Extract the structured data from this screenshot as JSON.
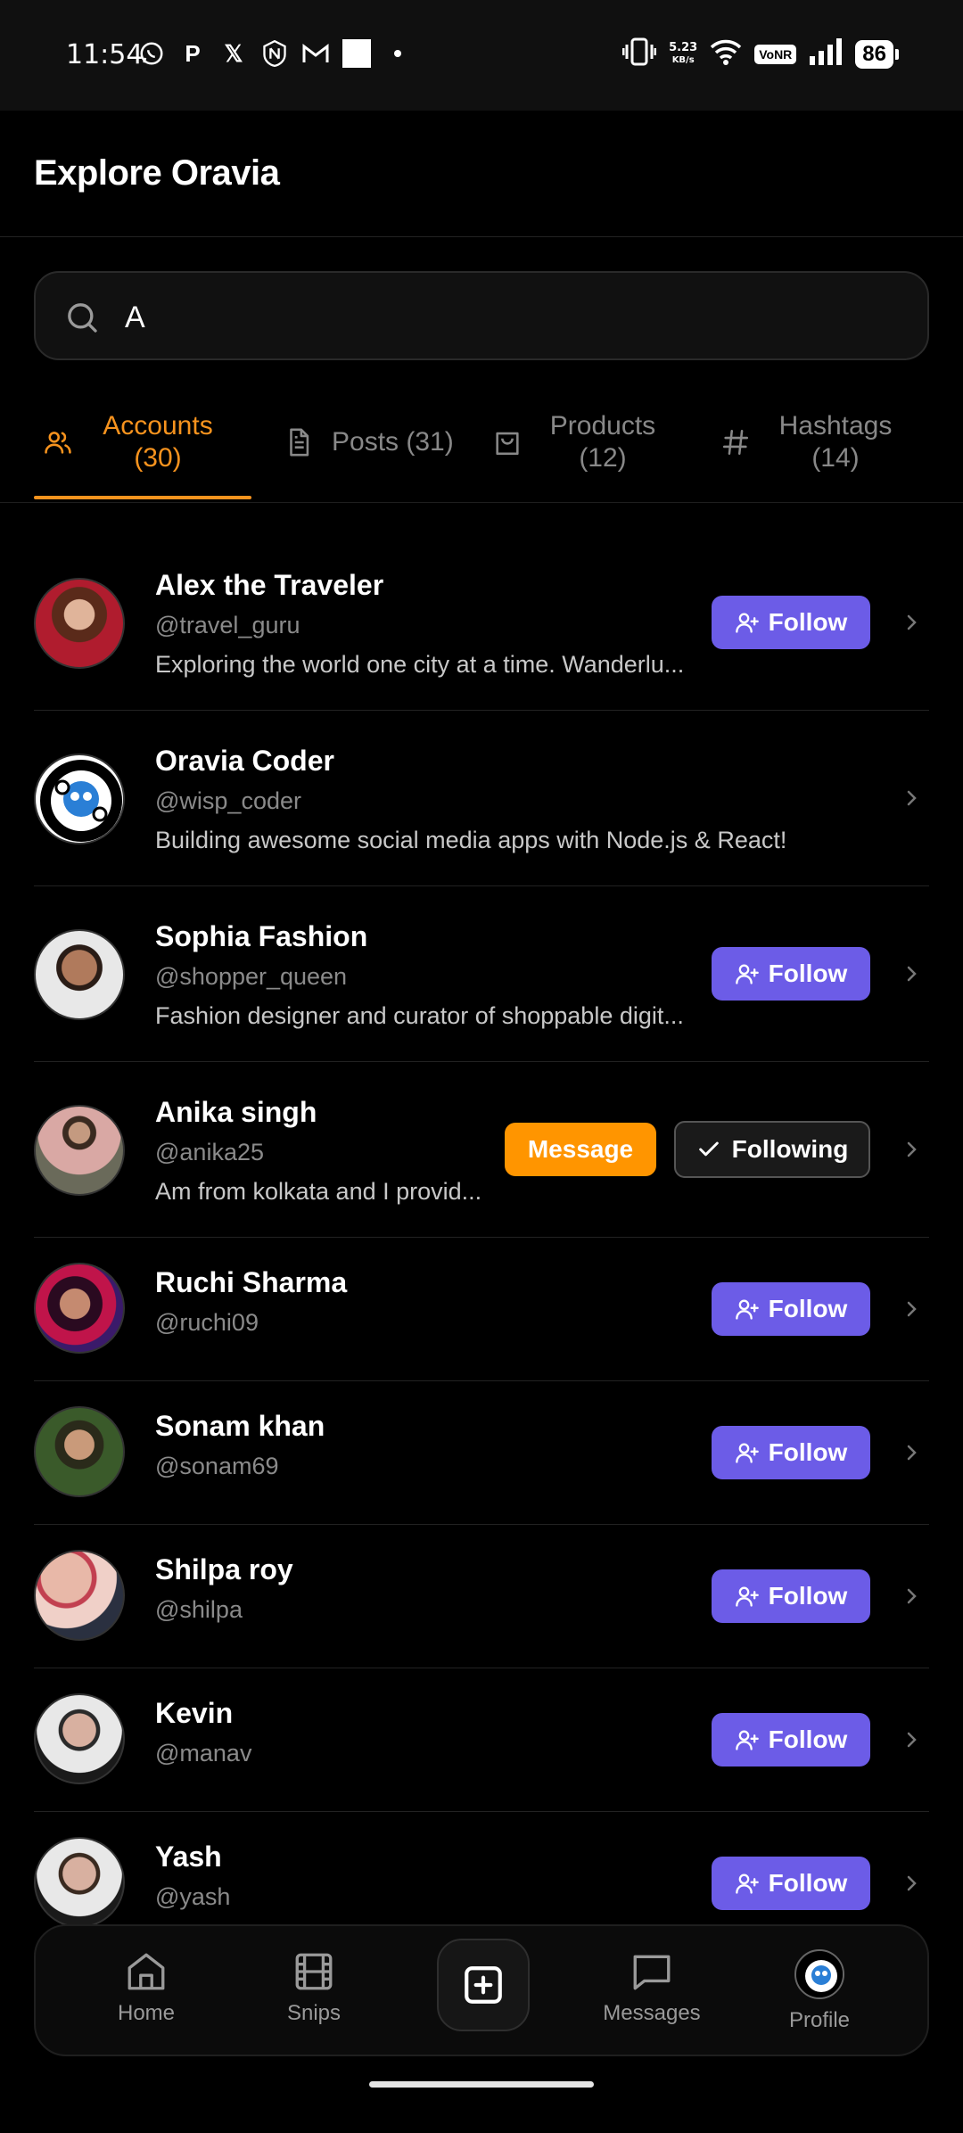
{
  "status_bar": {
    "time": "11:54",
    "net_speed_value": "5.23",
    "net_speed_unit": "KB/s",
    "vonr": "VoNR",
    "battery": "86"
  },
  "header": {
    "title": "Explore Oravia"
  },
  "search": {
    "value": "A",
    "placeholder": ""
  },
  "tabs": [
    {
      "label": "Accounts\n(30)",
      "l1": "Accounts",
      "l2": "(30)",
      "icon": "users-icon",
      "active": true
    },
    {
      "label": "Posts (31)",
      "l1": "Posts (31)",
      "icon": "document-icon",
      "active": false
    },
    {
      "label": "Products (12)",
      "l1": "Products",
      "l2": "(12)",
      "icon": "bag-icon",
      "active": false
    },
    {
      "label": "Hashtags (14)",
      "l1": "Hashtags",
      "l2": "(14)",
      "icon": "hash-icon",
      "active": false
    }
  ],
  "accounts": [
    {
      "name": "Alex the Traveler",
      "handle": "@travel_guru",
      "bio": "Exploring the world one city at a time. Wanderlu...",
      "action": "Follow"
    },
    {
      "name": "Oravia Coder",
      "handle": "@wisp_coder",
      "bio": "Building awesome social media apps with Node.js & React!"
    },
    {
      "name": "Sophia Fashion",
      "handle": "@shopper_queen",
      "bio": "Fashion designer and curator of shoppable digit...",
      "action": "Follow"
    },
    {
      "name": "Anika singh",
      "handle": "@anika25",
      "bio": "Am from kolkata and I provid...",
      "message": "Message",
      "following": "Following"
    },
    {
      "name": "Ruchi Sharma",
      "handle": "@ruchi09",
      "action": "Follow"
    },
    {
      "name": "Sonam khan",
      "handle": "@sonam69",
      "action": "Follow"
    },
    {
      "name": "Shilpa roy",
      "handle": "@shilpa",
      "action": "Follow"
    },
    {
      "name": "Kevin",
      "handle": "@manav",
      "action": "Follow"
    },
    {
      "name": "Yash",
      "handle": "@yash",
      "action": "Follow"
    }
  ],
  "bottom_nav": {
    "home": "Home",
    "snips": "Snips",
    "messages": "Messages",
    "profile": "Profile"
  },
  "colors": {
    "accent": "#f7931e",
    "follow": "#6c5ce7",
    "message": "#ff9500"
  }
}
